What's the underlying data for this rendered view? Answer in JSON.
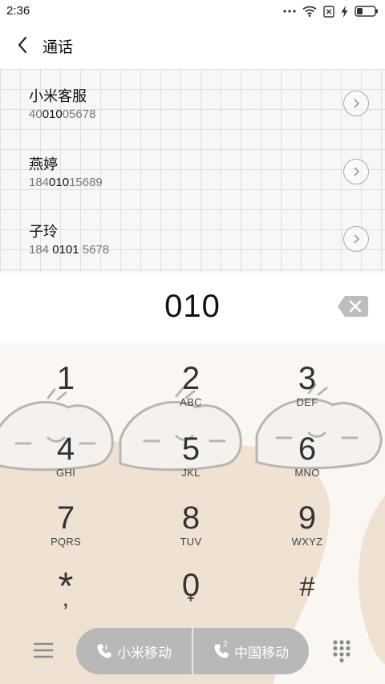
{
  "status_bar": {
    "time": "2:36",
    "icons": [
      "more-dots-icon",
      "wifi-icon",
      "sim-x-icon",
      "charging-bolt-icon",
      "battery-icon"
    ]
  },
  "header": {
    "title": "通话",
    "back_icon": "back-chevron-icon"
  },
  "contacts": [
    {
      "name": "小米客服",
      "number_pre": "40",
      "number_match": "010",
      "number_post": "05678"
    },
    {
      "name": "燕婷",
      "number_pre": "184",
      "number_match": "010",
      "number_post": "15689"
    },
    {
      "name": "子玲",
      "number_pre": "184 ",
      "number_match": "0101",
      "number_post": " 5678"
    }
  ],
  "dialed": {
    "number": "010",
    "backspace_icon": "backspace-icon"
  },
  "keypad": {
    "keys": [
      {
        "digit": "1",
        "letters": ""
      },
      {
        "digit": "2",
        "letters": "ABC"
      },
      {
        "digit": "3",
        "letters": "DEF"
      },
      {
        "digit": "4",
        "letters": "GHI"
      },
      {
        "digit": "5",
        "letters": "JKL"
      },
      {
        "digit": "6",
        "letters": "MNO"
      },
      {
        "digit": "7",
        "letters": "PQRS"
      },
      {
        "digit": "8",
        "letters": "TUV"
      },
      {
        "digit": "9",
        "letters": "WXYZ"
      },
      {
        "digit": "*",
        "letters": ","
      },
      {
        "digit": "0",
        "letters": "+"
      },
      {
        "digit": "#",
        "letters": ""
      }
    ]
  },
  "bottom_bar": {
    "menu_icon": "menu-lines-icon",
    "sim1_label": "小米移动",
    "sim2_label": "中国移动",
    "sim2_badge": "2",
    "dialpad_icon": "dialpad-grid-icon"
  },
  "colors": {
    "sim_button_bg": "#b8b8b8",
    "keypad_bg": "#faf6f2",
    "blob_color": "#efe2d3",
    "grid_line": "#dedee9"
  }
}
